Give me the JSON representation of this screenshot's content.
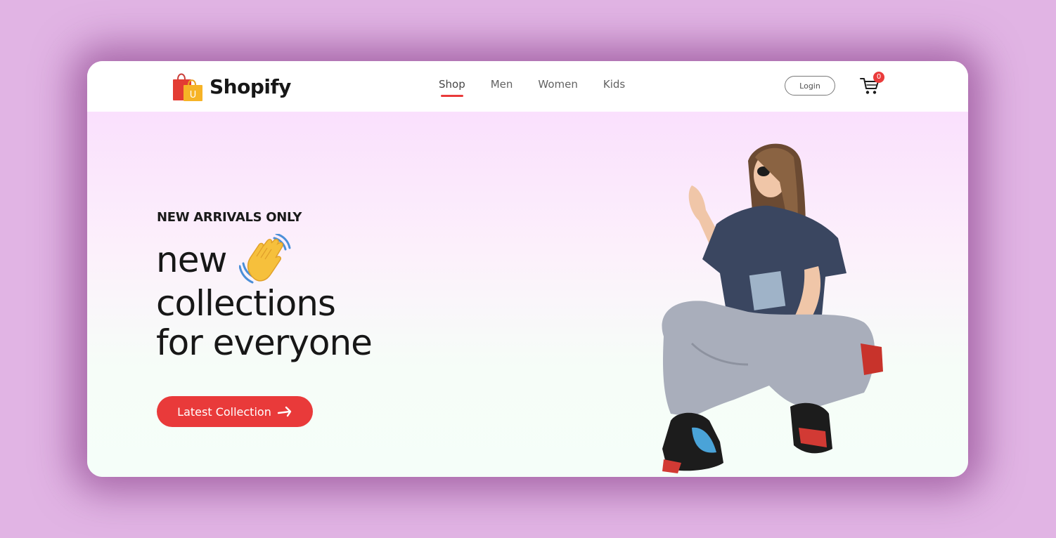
{
  "brand": {
    "name": "Shopify",
    "logo_letter": "U"
  },
  "nav": {
    "items": [
      {
        "label": "Shop",
        "active": true
      },
      {
        "label": "Men",
        "active": false
      },
      {
        "label": "Women",
        "active": false
      },
      {
        "label": "Kids",
        "active": false
      }
    ]
  },
  "header": {
    "login_label": "Login",
    "cart_count": "0"
  },
  "hero": {
    "tag": "NEW ARRIVALS ONLY",
    "title_line1": "new",
    "title_line2": "collections",
    "title_line3": "for everyone",
    "cta_label": "Latest Collection"
  },
  "colors": {
    "accent": "#e93a3a",
    "page_bg": "#e1b4e4",
    "text": "#171717"
  },
  "icons": [
    "shopping-bags-icon",
    "waving-hand-icon",
    "cart-icon",
    "arrow-right-icon"
  ]
}
